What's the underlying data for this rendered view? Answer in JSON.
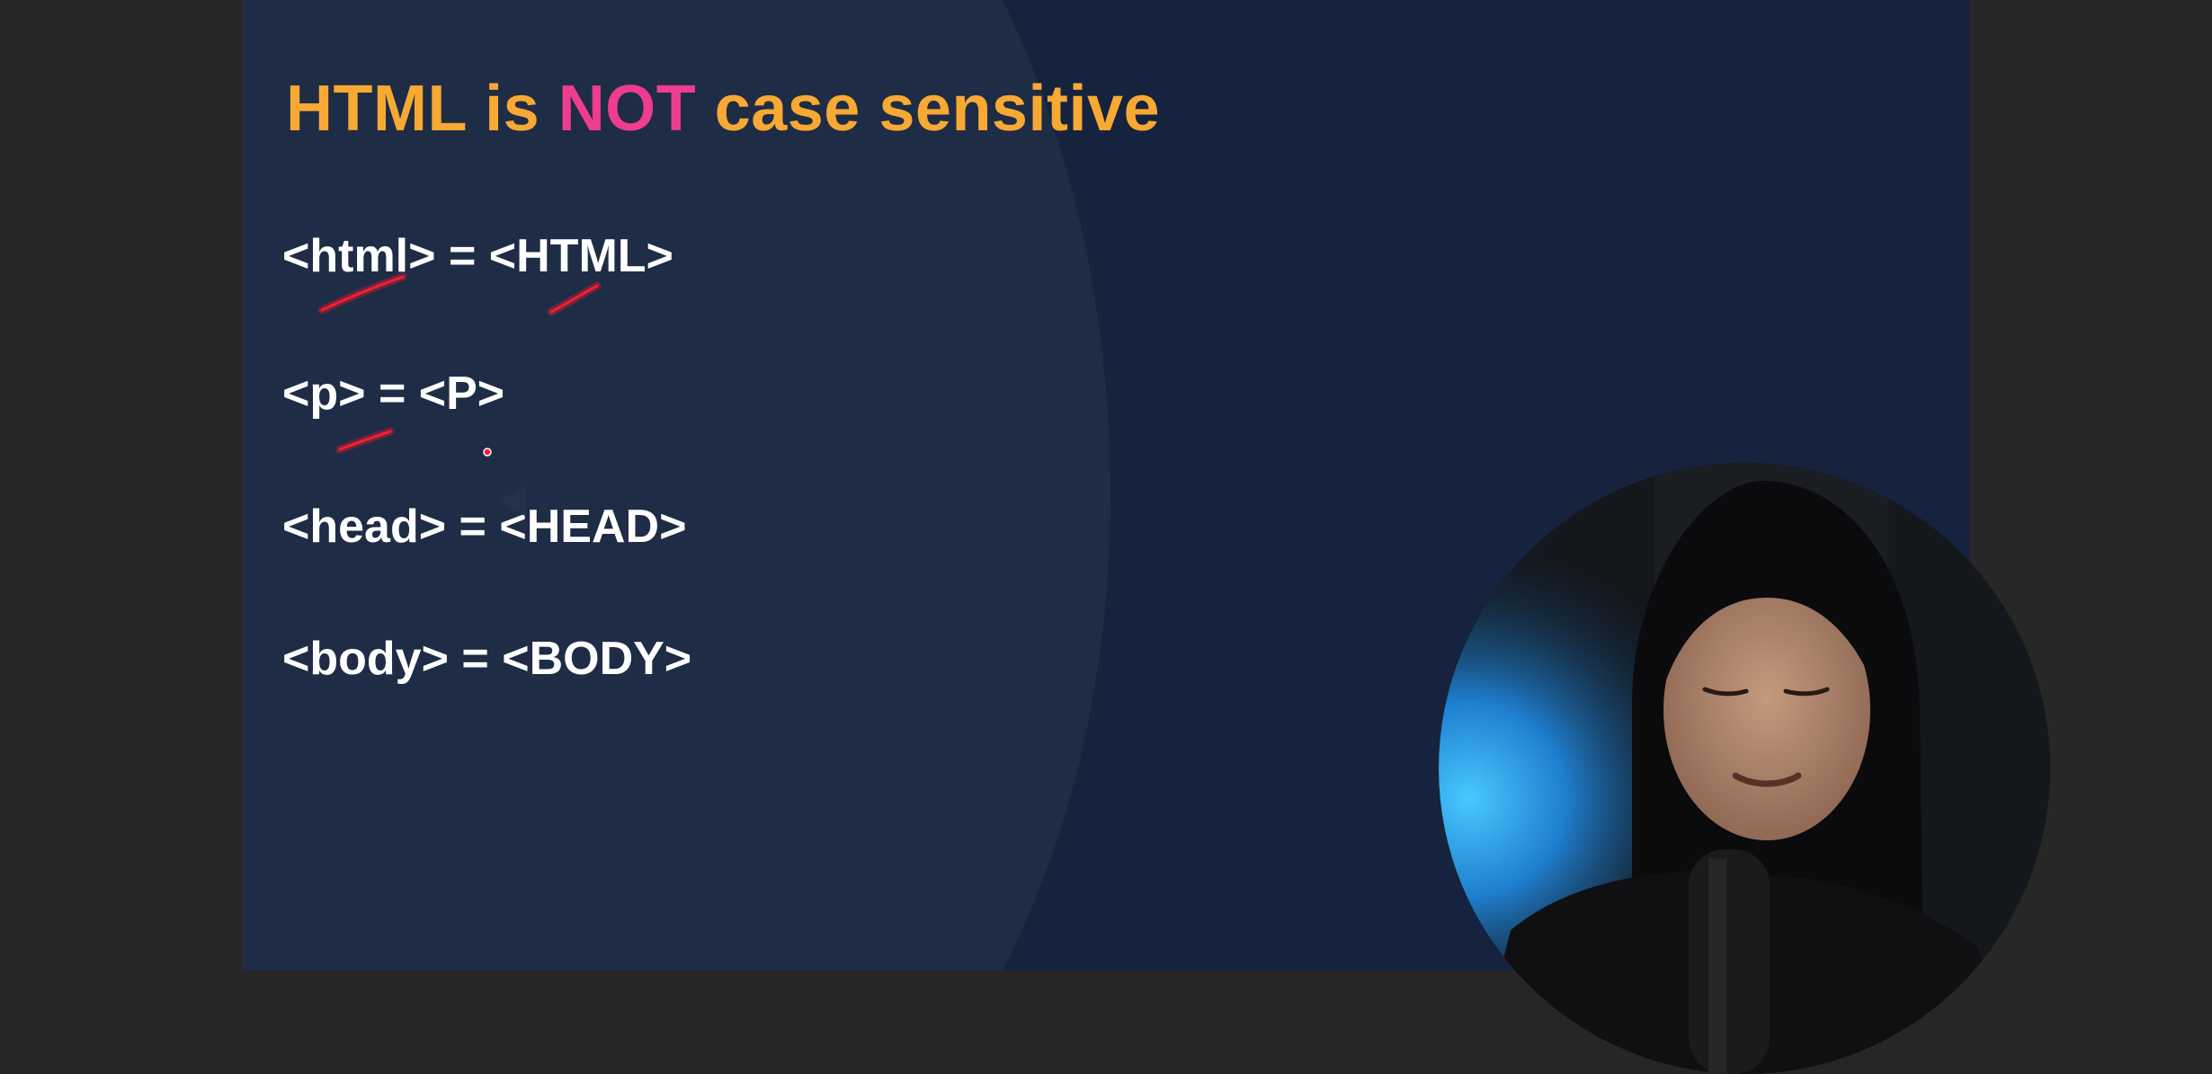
{
  "slide": {
    "title": {
      "part1": "HTML is ",
      "part2": "NOT",
      "part3": " case sensitive"
    },
    "lines": [
      "<html> = <HTML>",
      "<p> = <P>",
      "<head> = <HEAD>",
      "<body> = <BODY>"
    ]
  },
  "colors": {
    "title_orange": "#f7a934",
    "title_pink": "#ee3c8f",
    "slide_background": "#15233e",
    "annotation_red": "#ff1a2e"
  },
  "webcam": {
    "icon": "presenter-webcam-icon"
  }
}
